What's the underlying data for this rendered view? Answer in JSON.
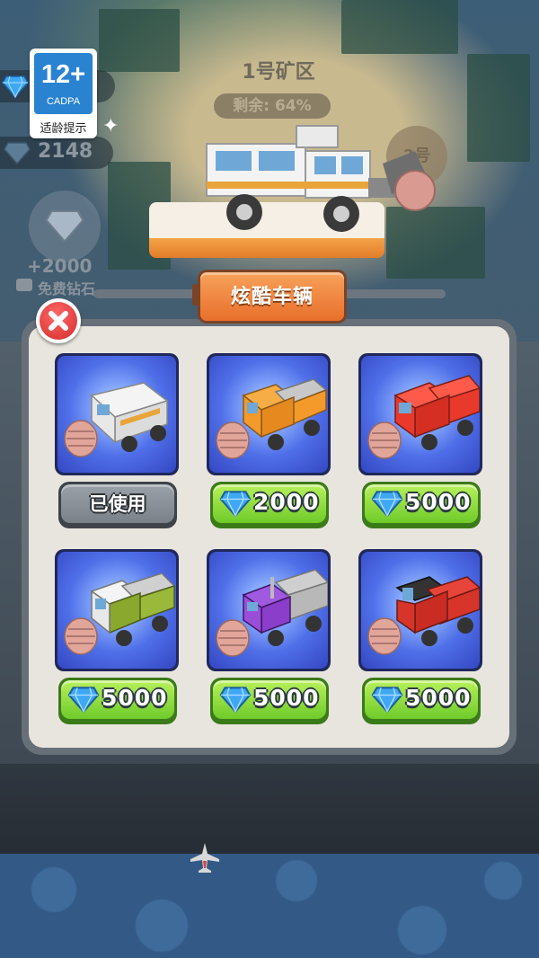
{
  "background": {
    "zone_title": "1号矿区",
    "zone_progress": "剩余: 64%",
    "zone_badge": "2号"
  },
  "hud": {
    "gem_count": "2148",
    "free_gems": {
      "amount": "+2000",
      "label": "免费钻石"
    }
  },
  "age_rating": {
    "rating": "12+",
    "org": "CADPA",
    "tip": "适龄提示"
  },
  "panel": {
    "title": "炫酷车辆"
  },
  "vehicles": [
    {
      "color": "white",
      "accent": "#f2f2f2",
      "status": "已使用",
      "price": ""
    },
    {
      "color": "orange",
      "accent": "#f39a2a",
      "status": "",
      "price": "2000"
    },
    {
      "color": "red",
      "accent": "#e8392b",
      "status": "",
      "price": "5000"
    },
    {
      "color": "green",
      "accent": "#9ab83a",
      "status": "",
      "price": "5000"
    },
    {
      "color": "purple",
      "accent": "#8a3ec9",
      "status": "",
      "price": "5000"
    },
    {
      "color": "darkred",
      "accent": "#d7352a",
      "status": "",
      "price": "5000"
    }
  ],
  "colors": {
    "button_green": "#6fcb2a",
    "button_gray": "#7a8189",
    "panel_bg": "#e8e5de",
    "card_blue": "#4f6fe8",
    "title_orange": "#e86f2b",
    "close_red": "#d42a2a"
  }
}
